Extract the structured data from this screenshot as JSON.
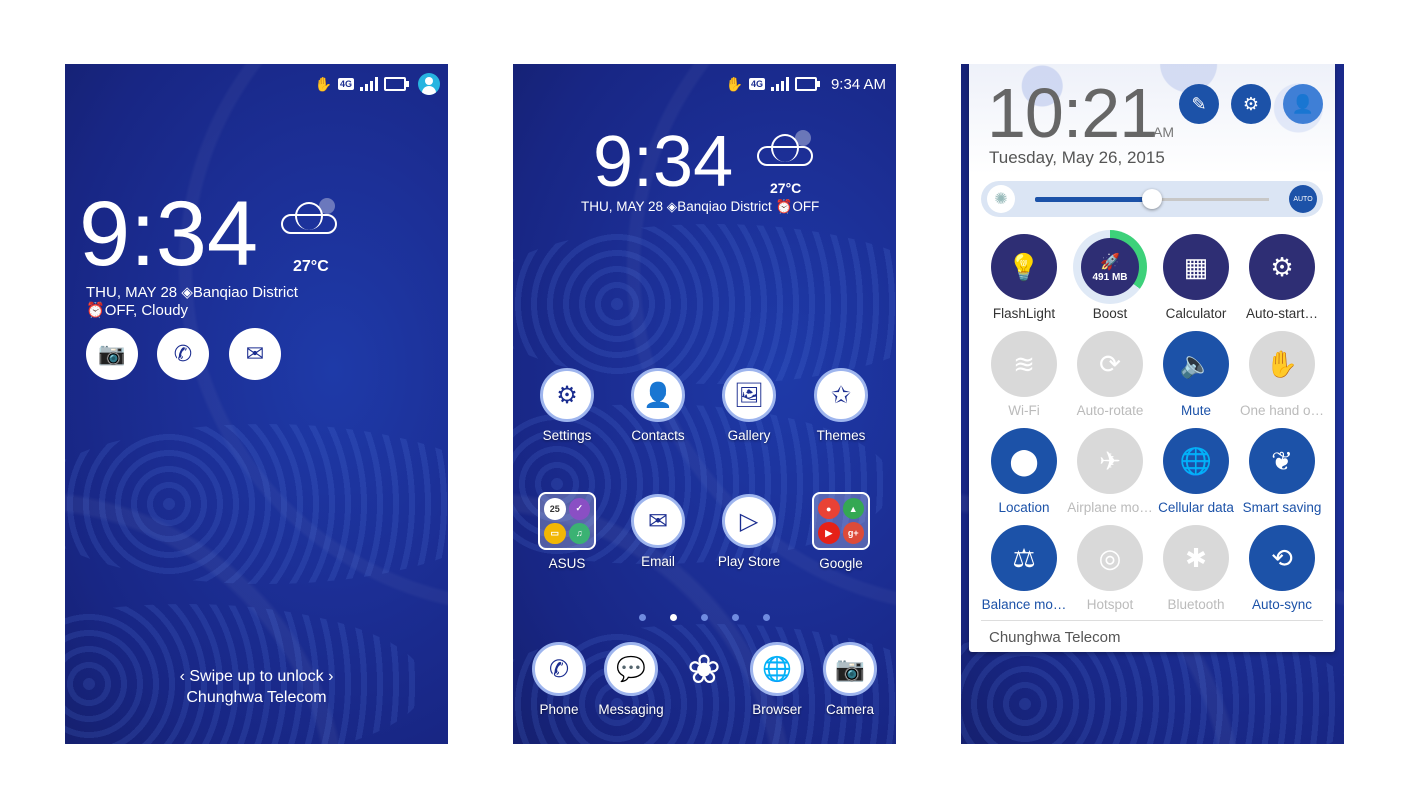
{
  "lock": {
    "time": "9:34",
    "temp": "27°C",
    "date": "THU, MAY 28",
    "location": "Banqiao District",
    "alarm": "OFF, Cloudy",
    "unlock_text": "Swipe up to unlock",
    "carrier": "Chunghwa Telecom",
    "shortcuts": [
      "camera-icon",
      "phone-icon",
      "message-icon"
    ]
  },
  "home": {
    "status_time": "9:34 AM",
    "time": "9:34",
    "temp": "27°C",
    "date": "THU, MAY 28",
    "location": "Banqiao District",
    "alarm": "OFF",
    "apps_row1": [
      "Settings",
      "Contacts",
      "Gallery",
      "Themes"
    ],
    "apps_row2": [
      "ASUS",
      "Email",
      "Play Store",
      "Google"
    ],
    "asus_folder_badge": "25",
    "dock": [
      "Phone",
      "Messaging",
      "Browser",
      "Camera"
    ],
    "page_count": 5,
    "active_page": 2
  },
  "quick": {
    "time": "10:21",
    "ampm": "AM",
    "date": "Tuesday, May 26, 2015",
    "brightness": 0.5,
    "auto_label": "AUTO",
    "boost_value": "491 MB",
    "tiles": [
      {
        "label": "FlashLight",
        "state": "dark"
      },
      {
        "label": "Boost",
        "state": "boost"
      },
      {
        "label": "Calculator",
        "state": "dark"
      },
      {
        "label": "Auto-start…",
        "state": "dark"
      },
      {
        "label": "Wi-Fi",
        "state": "off"
      },
      {
        "label": "Auto-rotate",
        "state": "off"
      },
      {
        "label": "Mute",
        "state": "blue"
      },
      {
        "label": "One hand o…",
        "state": "off"
      },
      {
        "label": "Location",
        "state": "blue"
      },
      {
        "label": "Airplane mo…",
        "state": "off"
      },
      {
        "label": "Cellular data",
        "state": "blue"
      },
      {
        "label": "Smart saving",
        "state": "blue"
      },
      {
        "label": "Balance mo…",
        "state": "blue"
      },
      {
        "label": "Hotspot",
        "state": "off"
      },
      {
        "label": "Bluetooth",
        "state": "off"
      },
      {
        "label": "Auto-sync",
        "state": "blue"
      }
    ],
    "carrier": "Chunghwa Telecom"
  },
  "colors": {
    "wallpaper": "#1c2f96",
    "accent": "#1c52a8",
    "dark_tile": "#2e2e74"
  }
}
